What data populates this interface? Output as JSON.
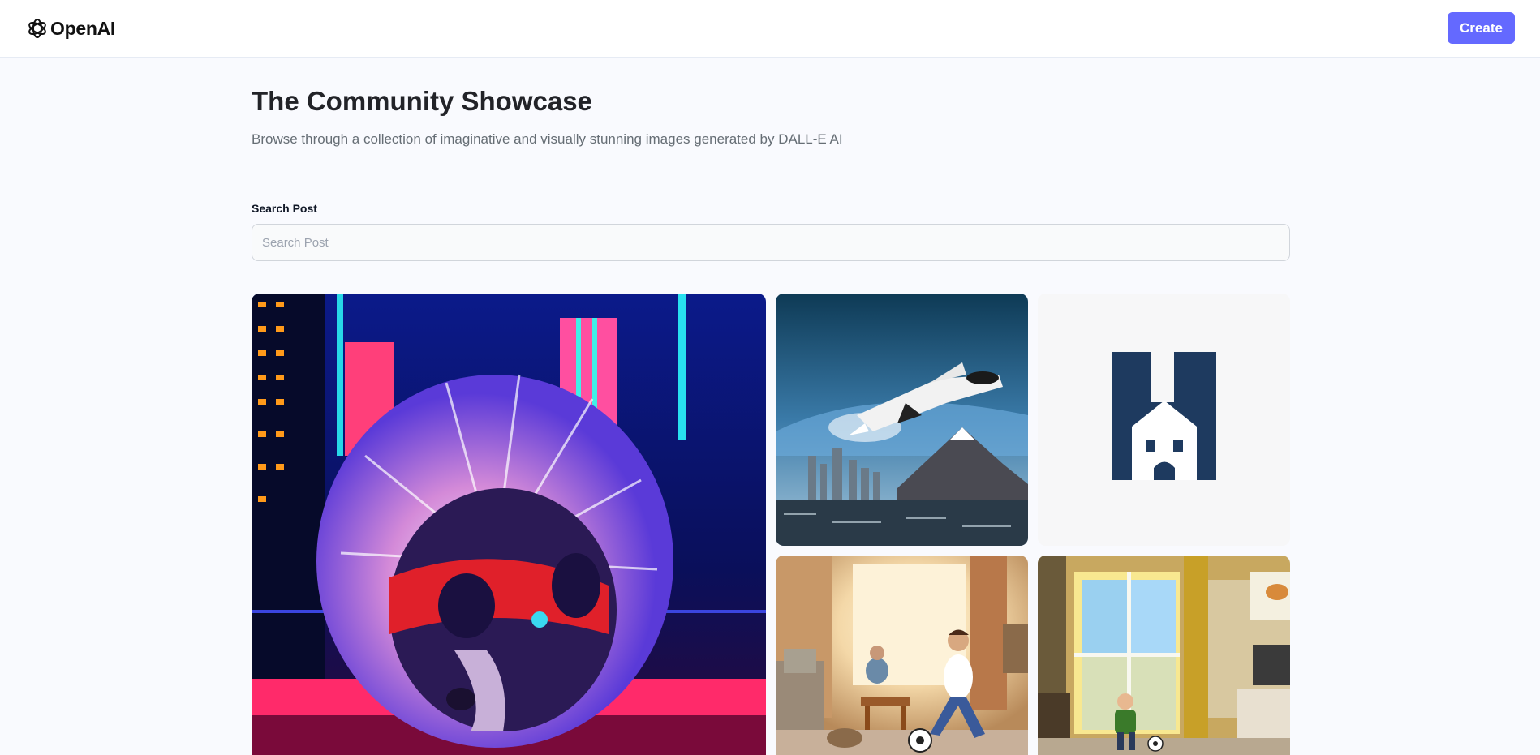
{
  "header": {
    "logo_text": "OpenAI",
    "create_label": "Create",
    "accent_color": "#6469ff"
  },
  "main": {
    "title": "The Community Showcase",
    "subtitle": "Browse through a collection of imaginative and visually stunning images generated by DALL-E AI"
  },
  "search": {
    "label": "Search Post",
    "placeholder": "Search Post",
    "value": ""
  },
  "gallery": {
    "cards": [
      {
        "depicts": "neon-hedgehog"
      },
      {
        "depicts": "space-shuttle-over-city"
      },
      {
        "depicts": "house-logo"
      },
      {
        "depicts": "boy-playing-soccer-living-room"
      },
      {
        "depicts": "child-playing-soccer-sunny-room"
      }
    ]
  }
}
